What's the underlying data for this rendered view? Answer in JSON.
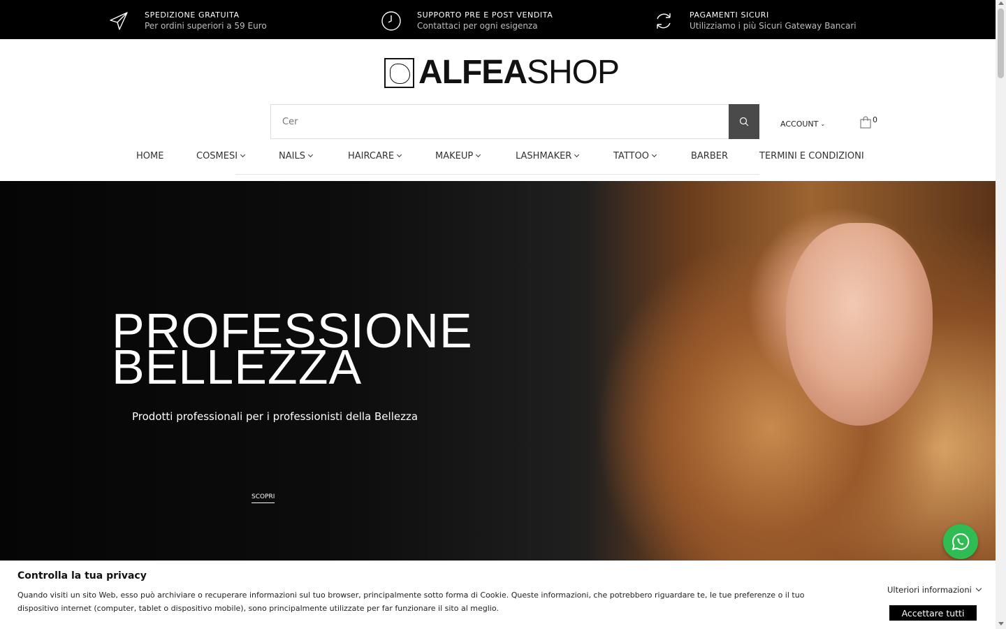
{
  "topbar": {
    "items": [
      {
        "icon": "paper-plane-icon",
        "title": "SPEDIZIONE GRATUITA",
        "subtitle": "Per ordini superiori a 59 Euro"
      },
      {
        "icon": "clock-icon",
        "title": "SUPPORTO PRE E POST VENDITA",
        "subtitle": "Contattaci per ogni esigenza"
      },
      {
        "icon": "refresh-icon",
        "title": "PAGAMENTI SICURI",
        "subtitle": "Utilizziamo i più Sicuri Gateway Bancari"
      }
    ]
  },
  "header": {
    "logo_bold": "ALFEA",
    "logo_light": "SHOP",
    "search_placeholder": "Cer",
    "account_label": "ACCOUNT",
    "cart_count": "0"
  },
  "nav": {
    "items": [
      {
        "label": "HOME",
        "has_dropdown": false
      },
      {
        "label": "COSMESI",
        "has_dropdown": true
      },
      {
        "label": "NAILS",
        "has_dropdown": true
      },
      {
        "label": "HAIRCARE",
        "has_dropdown": true
      },
      {
        "label": "MAKEUP",
        "has_dropdown": true
      },
      {
        "label": "LASHMAKER",
        "has_dropdown": true
      },
      {
        "label": "TATTOO",
        "has_dropdown": true
      },
      {
        "label": "BARBER",
        "has_dropdown": false
      },
      {
        "label": "TERMINI E CONDIZIONI",
        "has_dropdown": false
      }
    ]
  },
  "hero": {
    "title_line1": "PROFESSIONE",
    "title_line2": "BELLEZZA",
    "subtitle": "Prodotti professionali per i professionisti della Bellezza",
    "cta": "SCOPRI"
  },
  "cookie": {
    "title": "Controlla la tua privacy",
    "text": "Quando visiti un sito Web, esso può archiviare o recuperare informazioni sul tuo browser, principalmente sotto forma di Cookie. Queste informazioni, che potrebbero riguardare te, le tue preferenze o il tuo dispositivo internet (computer, tablet o dispositivo mobile), sono principalmente utilizzate per far funzionare il sito al meglio.",
    "more_label": "Ulteriori informazioni",
    "accept_label": "Accettare tutti"
  },
  "colors": {
    "topbar_bg": "#000000",
    "search_button": "#4a4a4a",
    "whatsapp": "#2fbc52",
    "accept_button": "#000000"
  }
}
